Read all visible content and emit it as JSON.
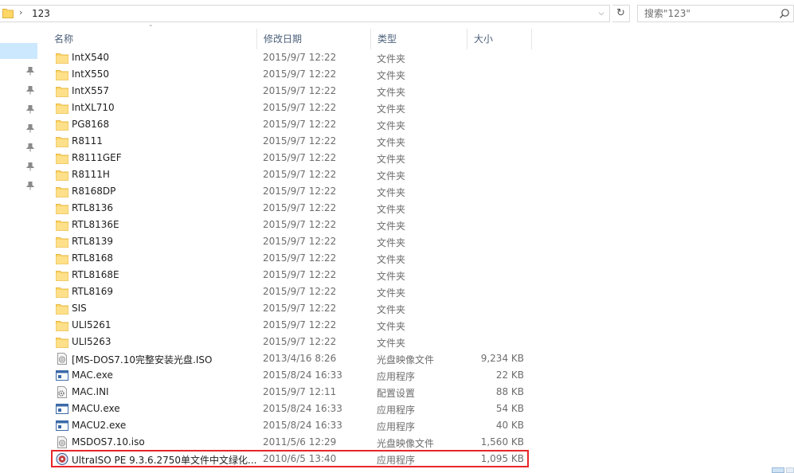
{
  "address": {
    "crumbs": [
      "123"
    ],
    "separator": "›"
  },
  "search": {
    "placeholder": "搜索\"123\""
  },
  "columns": {
    "name": "名称",
    "date": "修改日期",
    "type": "类型",
    "size": "大小"
  },
  "files": [
    {
      "name": "IntX540",
      "date": "2015/9/7 12:22",
      "type": "文件夹",
      "size": "",
      "icon": "folder-icon"
    },
    {
      "name": "IntX550",
      "date": "2015/9/7 12:22",
      "type": "文件夹",
      "size": "",
      "icon": "folder-icon"
    },
    {
      "name": "IntX557",
      "date": "2015/9/7 12:22",
      "type": "文件夹",
      "size": "",
      "icon": "folder-icon"
    },
    {
      "name": "IntXL710",
      "date": "2015/9/7 12:22",
      "type": "文件夹",
      "size": "",
      "icon": "folder-icon"
    },
    {
      "name": "PG8168",
      "date": "2015/9/7 12:22",
      "type": "文件夹",
      "size": "",
      "icon": "folder-icon"
    },
    {
      "name": "R8111",
      "date": "2015/9/7 12:22",
      "type": "文件夹",
      "size": "",
      "icon": "folder-icon"
    },
    {
      "name": "R8111GEF",
      "date": "2015/9/7 12:22",
      "type": "文件夹",
      "size": "",
      "icon": "folder-icon"
    },
    {
      "name": "R8111H",
      "date": "2015/9/7 12:22",
      "type": "文件夹",
      "size": "",
      "icon": "folder-icon"
    },
    {
      "name": "R8168DP",
      "date": "2015/9/7 12:22",
      "type": "文件夹",
      "size": "",
      "icon": "folder-icon"
    },
    {
      "name": "RTL8136",
      "date": "2015/9/7 12:22",
      "type": "文件夹",
      "size": "",
      "icon": "folder-icon"
    },
    {
      "name": "RTL8136E",
      "date": "2015/9/7 12:22",
      "type": "文件夹",
      "size": "",
      "icon": "folder-icon"
    },
    {
      "name": "RTL8139",
      "date": "2015/9/7 12:22",
      "type": "文件夹",
      "size": "",
      "icon": "folder-icon"
    },
    {
      "name": "RTL8168",
      "date": "2015/9/7 12:22",
      "type": "文件夹",
      "size": "",
      "icon": "folder-icon"
    },
    {
      "name": "RTL8168E",
      "date": "2015/9/7 12:22",
      "type": "文件夹",
      "size": "",
      "icon": "folder-icon"
    },
    {
      "name": "RTL8169",
      "date": "2015/9/7 12:22",
      "type": "文件夹",
      "size": "",
      "icon": "folder-icon"
    },
    {
      "name": "SIS",
      "date": "2015/9/7 12:22",
      "type": "文件夹",
      "size": "",
      "icon": "folder-icon"
    },
    {
      "name": "ULI5261",
      "date": "2015/9/7 12:22",
      "type": "文件夹",
      "size": "",
      "icon": "folder-icon"
    },
    {
      "name": "ULI5263",
      "date": "2015/9/7 12:22",
      "type": "文件夹",
      "size": "",
      "icon": "folder-icon"
    },
    {
      "name": "[MS-DOS7.10完整安装光盘.ISO",
      "date": "2013/4/16 8:26",
      "type": "光盘映像文件",
      "size": "9,234 KB",
      "icon": "disc-image-icon"
    },
    {
      "name": "MAC.exe",
      "date": "2015/8/24 16:33",
      "type": "应用程序",
      "size": "22 KB",
      "icon": "application-icon"
    },
    {
      "name": "MAC.INI",
      "date": "2015/9/7 12:11",
      "type": "配置设置",
      "size": "88 KB",
      "icon": "settings-file-icon"
    },
    {
      "name": "MACU.exe",
      "date": "2015/8/24 16:33",
      "type": "应用程序",
      "size": "54 KB",
      "icon": "application-icon"
    },
    {
      "name": "MACU2.exe",
      "date": "2015/8/24 16:33",
      "type": "应用程序",
      "size": "40 KB",
      "icon": "application-icon"
    },
    {
      "name": "MSDOS7.10.iso",
      "date": "2011/5/6 12:29",
      "type": "光盘映像文件",
      "size": "1,560 KB",
      "icon": "disc-image-icon"
    },
    {
      "name": "UltraISO PE 9.3.6.2750单文件中文绿化...",
      "date": "2010/6/5 13:40",
      "type": "应用程序",
      "size": "1,095 KB",
      "icon": "ultraiso-app-icon"
    }
  ],
  "colors": {
    "folder": "#ffd766",
    "selection": "#cce8ff",
    "highlight_box": "#e8262a",
    "header_text": "#4c607a"
  }
}
